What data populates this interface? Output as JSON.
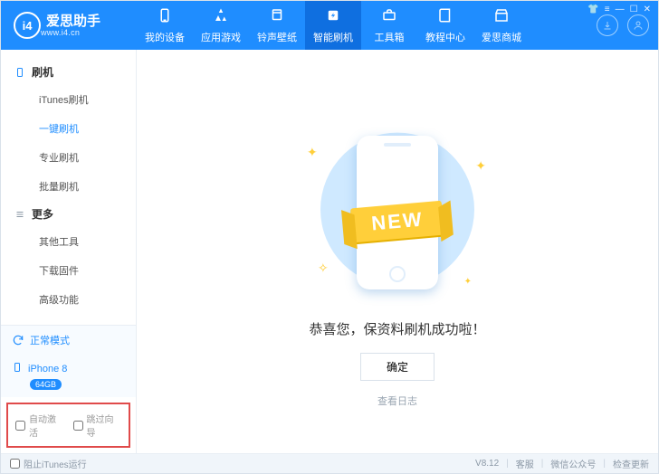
{
  "header": {
    "logo_letters": "i4",
    "title_cn": "爱思助手",
    "title_en": "www.i4.cn",
    "nav": [
      {
        "label": "我的设备",
        "icon": "phone-icon"
      },
      {
        "label": "应用游戏",
        "icon": "apps-icon"
      },
      {
        "label": "铃声壁纸",
        "icon": "music-icon"
      },
      {
        "label": "智能刷机",
        "icon": "flash-icon"
      },
      {
        "label": "工具箱",
        "icon": "toolbox-icon"
      },
      {
        "label": "教程中心",
        "icon": "book-icon"
      },
      {
        "label": "爱思商城",
        "icon": "store-icon"
      }
    ],
    "active_nav_index": 3
  },
  "sidebar": {
    "sections": [
      {
        "title": "刷机",
        "icon": "phone-outline-icon",
        "items": [
          "iTunes刷机",
          "一键刷机",
          "专业刷机",
          "批量刷机"
        ],
        "active_index": 1
      },
      {
        "title": "更多",
        "icon": "list-icon",
        "items": [
          "其他工具",
          "下载固件",
          "高级功能"
        ],
        "active_index": -1
      }
    ],
    "status_label": "正常模式",
    "device": {
      "name": "iPhone 8",
      "storage": "64GB"
    },
    "options": {
      "auto_activate": "自动激活",
      "skip_guide": "跳过向导"
    }
  },
  "main": {
    "ribbon": "NEW",
    "success_text": "恭喜您，保资料刷机成功啦！",
    "ok_label": "确定",
    "view_log_label": "查看日志"
  },
  "footer": {
    "block_itunes": "阻止iTunes运行",
    "version": "V8.12",
    "links": [
      "客服",
      "微信公众号",
      "检查更新"
    ]
  },
  "colors": {
    "brand": "#1f8dff"
  }
}
